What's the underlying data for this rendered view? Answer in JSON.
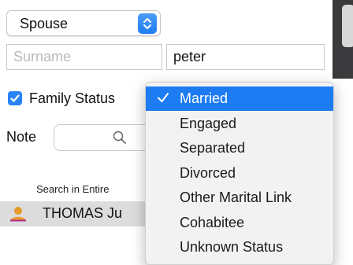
{
  "relation": {
    "selected": "Spouse"
  },
  "name": {
    "surname_placeholder": "Surname",
    "firstname_value": "peter"
  },
  "family_status": {
    "label": "Family Status",
    "checked": true
  },
  "note": {
    "label": "Note"
  },
  "search_hint": "Search in Entire",
  "person": {
    "name": "THOMAS Ju"
  },
  "status_menu": {
    "items": [
      {
        "label": "Married",
        "selected": true
      },
      {
        "label": "Engaged",
        "selected": false
      },
      {
        "label": "Separated",
        "selected": false
      },
      {
        "label": "Divorced",
        "selected": false
      },
      {
        "label": "Other Marital Link",
        "selected": false
      },
      {
        "label": "Cohabitee",
        "selected": false
      },
      {
        "label": "Unknown Status",
        "selected": false
      }
    ]
  },
  "colors": {
    "accent": "#1e7cf2",
    "person_icon": "#e59b2a"
  },
  "icons": [
    "chevron-updown-icon",
    "checkmark-icon",
    "magnifier-icon",
    "person-icon"
  ]
}
